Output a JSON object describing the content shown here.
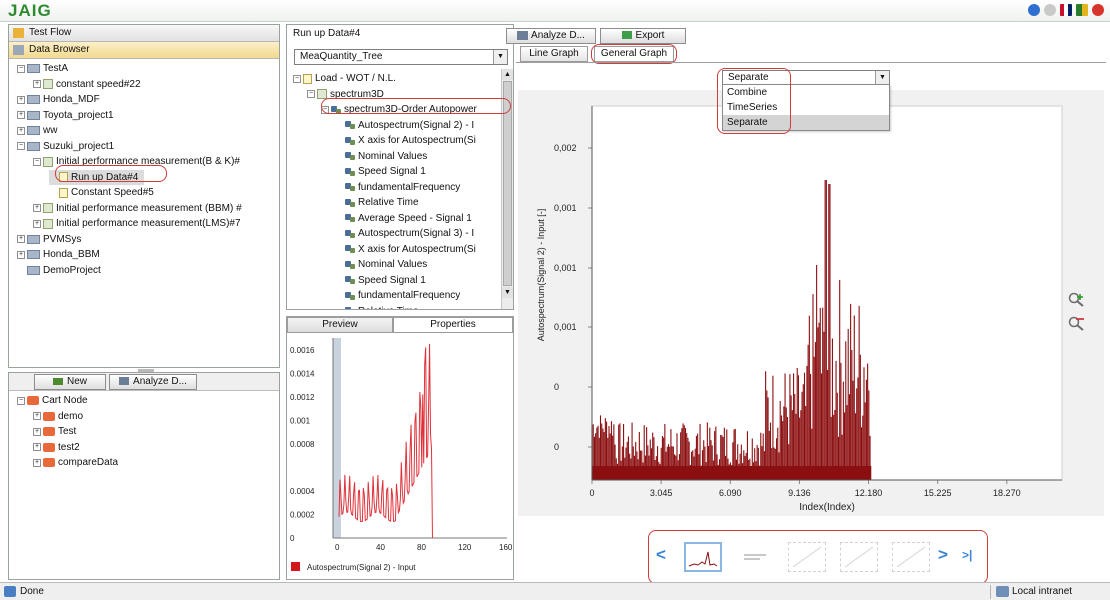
{
  "app": {
    "title": "JAIG"
  },
  "left": {
    "test_flow": "Test Flow",
    "data_browser": "Data Browser",
    "tree": [
      {
        "label": "TestA",
        "indent": 0,
        "pm": "−",
        "icon": "folder"
      },
      {
        "label": "constant speed#22",
        "indent": 1,
        "pm": "+",
        "icon": "docg"
      },
      {
        "label": "Honda_MDF",
        "indent": 0,
        "pm": "+",
        "icon": "folder"
      },
      {
        "label": "Toyota_project1",
        "indent": 0,
        "pm": "+",
        "icon": "folder"
      },
      {
        "label": "ww",
        "indent": 0,
        "pm": "+",
        "icon": "folder"
      },
      {
        "label": "Suzuki_project1",
        "indent": 0,
        "pm": "−",
        "icon": "folder"
      },
      {
        "label": "Initial performance measurement(B & K)#",
        "indent": 1,
        "pm": "−",
        "icon": "docg"
      },
      {
        "label": "Run up Data#4",
        "indent": 2,
        "pm": "",
        "icon": "doc",
        "selected": true
      },
      {
        "label": "Constant Speed#5",
        "indent": 2,
        "pm": "",
        "icon": "doc"
      },
      {
        "label": "Initial performance measurement (BBM) #",
        "indent": 1,
        "pm": "+",
        "icon": "docg"
      },
      {
        "label": "Initial performance measurement(LMS)#7",
        "indent": 1,
        "pm": "+",
        "icon": "docg"
      },
      {
        "label": "PVMSys",
        "indent": 0,
        "pm": "+",
        "icon": "folder"
      },
      {
        "label": "Honda_BBM",
        "indent": 0,
        "pm": "+",
        "icon": "folder"
      },
      {
        "label": "DemoProject",
        "indent": 0,
        "pm": "",
        "icon": "folder"
      }
    ],
    "new_button": "New",
    "analyze_button": "Analyze D...",
    "cart_tree": [
      {
        "label": "Cart Node",
        "indent": 0,
        "pm": "−",
        "icon": "cart"
      },
      {
        "label": "demo",
        "indent": 1,
        "pm": "+",
        "icon": "cart"
      },
      {
        "label": "Test",
        "indent": 1,
        "pm": "+",
        "icon": "cart"
      },
      {
        "label": "test2",
        "indent": 1,
        "pm": "+",
        "icon": "cart"
      },
      {
        "label": "compareData",
        "indent": 1,
        "pm": "+",
        "icon": "cart"
      }
    ]
  },
  "middle": {
    "title": "Run up Data#4",
    "select_value": "MeaQuantity_Tree",
    "tree": [
      {
        "label": "Load - WOT / N.L.",
        "indent": 0,
        "pm": "−",
        "icon": "doc"
      },
      {
        "label": "spectrum3D",
        "indent": 1,
        "pm": "−",
        "icon": "docg"
      },
      {
        "label": "spectrum3D-Order Autopower",
        "indent": 2,
        "pm": "−",
        "icon": "ch",
        "highlight": true
      },
      {
        "label": "Autospectrum(Signal 2) - I",
        "indent": 3,
        "pm": "",
        "icon": "ch"
      },
      {
        "label": "X axis for Autospectrum(Si",
        "indent": 3,
        "pm": "",
        "icon": "ch"
      },
      {
        "label": "Nominal Values",
        "indent": 3,
        "pm": "",
        "icon": "ch"
      },
      {
        "label": "Speed Signal 1",
        "indent": 3,
        "pm": "",
        "icon": "ch"
      },
      {
        "label": "fundamentalFrequency",
        "indent": 3,
        "pm": "",
        "icon": "ch"
      },
      {
        "label": "Relative Time",
        "indent": 3,
        "pm": "",
        "icon": "ch"
      },
      {
        "label": "Average Speed - Signal 1",
        "indent": 3,
        "pm": "",
        "icon": "ch"
      },
      {
        "label": "Autospectrum(Signal 3) - I",
        "indent": 3,
        "pm": "",
        "icon": "ch"
      },
      {
        "label": "X axis for Autospectrum(Si",
        "indent": 3,
        "pm": "",
        "icon": "ch"
      },
      {
        "label": "Nominal Values",
        "indent": 3,
        "pm": "",
        "icon": "ch"
      },
      {
        "label": "Speed Signal 1",
        "indent": 3,
        "pm": "",
        "icon": "ch"
      },
      {
        "label": "fundamentalFrequency",
        "indent": 3,
        "pm": "",
        "icon": "ch"
      },
      {
        "label": "Relative Time",
        "indent": 3,
        "pm": "",
        "icon": "ch"
      }
    ],
    "preview_tab": "Preview",
    "properties_tab": "Properties",
    "preview_legend": "Autospectrum(Signal 2) - Input",
    "preview_y_ticks": [
      "0.0016",
      "0.0014",
      "0.0012",
      "0.001",
      "0.0008",
      "0.0004",
      "0.0002",
      "0"
    ],
    "preview_x_ticks": [
      "0",
      "40",
      "80",
      "120",
      "160"
    ]
  },
  "right": {
    "analyze_button": "Analyze D...",
    "export_button": "Export",
    "line_graph_tab": "Line Graph",
    "general_graph_tab": "General Graph",
    "mode_select_value": "Separate",
    "mode_options": [
      "Combine",
      "TimeSeries",
      "Separate"
    ],
    "y_ticks": [
      "0,002",
      "0,001",
      "0,001",
      "0,001",
      "0",
      "0"
    ],
    "x_ticks": [
      "0",
      "3.045",
      "6.090",
      "9.136",
      "12.180",
      "15.225",
      "18.270"
    ],
    "ylabel": "Autospectrum(Signal 2) - Input [-]",
    "xlabel": "Index(Index)",
    "nav_prev": "<",
    "nav_next": ">",
    "nav_last": ">|"
  },
  "status": {
    "left": "Done",
    "right": "Local intranet"
  },
  "colors": {
    "bar": "#8b0e10",
    "preview_line": "#e0323a",
    "highlight": "#d23b3b",
    "logo": "#2f8a2f"
  }
}
